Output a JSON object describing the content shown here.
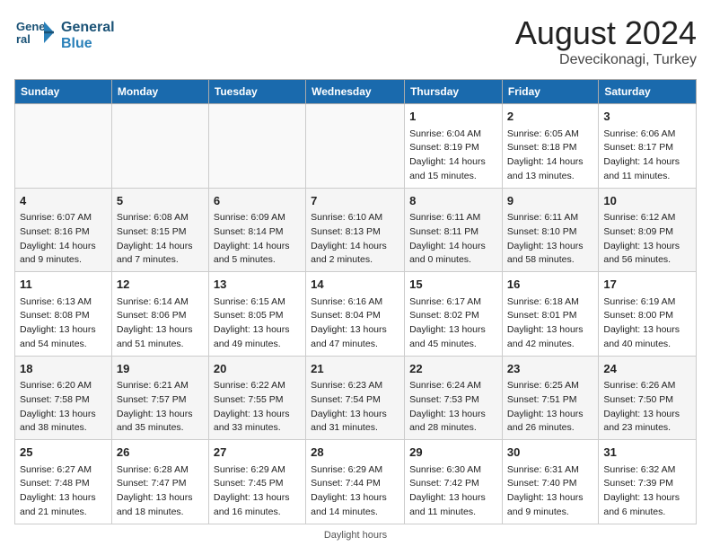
{
  "app": {
    "logo_line1": "General",
    "logo_line2": "Blue"
  },
  "title": {
    "month_year": "August 2024",
    "location": "Devecikonagi, Turkey"
  },
  "days_of_week": [
    "Sunday",
    "Monday",
    "Tuesday",
    "Wednesday",
    "Thursday",
    "Friday",
    "Saturday"
  ],
  "weeks": [
    [
      {
        "day": "",
        "content": ""
      },
      {
        "day": "",
        "content": ""
      },
      {
        "day": "",
        "content": ""
      },
      {
        "day": "",
        "content": ""
      },
      {
        "day": "1",
        "content": "Sunrise: 6:04 AM\nSunset: 8:19 PM\nDaylight: 14 hours and 15 minutes."
      },
      {
        "day": "2",
        "content": "Sunrise: 6:05 AM\nSunset: 8:18 PM\nDaylight: 14 hours and 13 minutes."
      },
      {
        "day": "3",
        "content": "Sunrise: 6:06 AM\nSunset: 8:17 PM\nDaylight: 14 hours and 11 minutes."
      }
    ],
    [
      {
        "day": "4",
        "content": "Sunrise: 6:07 AM\nSunset: 8:16 PM\nDaylight: 14 hours and 9 minutes."
      },
      {
        "day": "5",
        "content": "Sunrise: 6:08 AM\nSunset: 8:15 PM\nDaylight: 14 hours and 7 minutes."
      },
      {
        "day": "6",
        "content": "Sunrise: 6:09 AM\nSunset: 8:14 PM\nDaylight: 14 hours and 5 minutes."
      },
      {
        "day": "7",
        "content": "Sunrise: 6:10 AM\nSunset: 8:13 PM\nDaylight: 14 hours and 2 minutes."
      },
      {
        "day": "8",
        "content": "Sunrise: 6:11 AM\nSunset: 8:11 PM\nDaylight: 14 hours and 0 minutes."
      },
      {
        "day": "9",
        "content": "Sunrise: 6:11 AM\nSunset: 8:10 PM\nDaylight: 13 hours and 58 minutes."
      },
      {
        "day": "10",
        "content": "Sunrise: 6:12 AM\nSunset: 8:09 PM\nDaylight: 13 hours and 56 minutes."
      }
    ],
    [
      {
        "day": "11",
        "content": "Sunrise: 6:13 AM\nSunset: 8:08 PM\nDaylight: 13 hours and 54 minutes."
      },
      {
        "day": "12",
        "content": "Sunrise: 6:14 AM\nSunset: 8:06 PM\nDaylight: 13 hours and 51 minutes."
      },
      {
        "day": "13",
        "content": "Sunrise: 6:15 AM\nSunset: 8:05 PM\nDaylight: 13 hours and 49 minutes."
      },
      {
        "day": "14",
        "content": "Sunrise: 6:16 AM\nSunset: 8:04 PM\nDaylight: 13 hours and 47 minutes."
      },
      {
        "day": "15",
        "content": "Sunrise: 6:17 AM\nSunset: 8:02 PM\nDaylight: 13 hours and 45 minutes."
      },
      {
        "day": "16",
        "content": "Sunrise: 6:18 AM\nSunset: 8:01 PM\nDaylight: 13 hours and 42 minutes."
      },
      {
        "day": "17",
        "content": "Sunrise: 6:19 AM\nSunset: 8:00 PM\nDaylight: 13 hours and 40 minutes."
      }
    ],
    [
      {
        "day": "18",
        "content": "Sunrise: 6:20 AM\nSunset: 7:58 PM\nDaylight: 13 hours and 38 minutes."
      },
      {
        "day": "19",
        "content": "Sunrise: 6:21 AM\nSunset: 7:57 PM\nDaylight: 13 hours and 35 minutes."
      },
      {
        "day": "20",
        "content": "Sunrise: 6:22 AM\nSunset: 7:55 PM\nDaylight: 13 hours and 33 minutes."
      },
      {
        "day": "21",
        "content": "Sunrise: 6:23 AM\nSunset: 7:54 PM\nDaylight: 13 hours and 31 minutes."
      },
      {
        "day": "22",
        "content": "Sunrise: 6:24 AM\nSunset: 7:53 PM\nDaylight: 13 hours and 28 minutes."
      },
      {
        "day": "23",
        "content": "Sunrise: 6:25 AM\nSunset: 7:51 PM\nDaylight: 13 hours and 26 minutes."
      },
      {
        "day": "24",
        "content": "Sunrise: 6:26 AM\nSunset: 7:50 PM\nDaylight: 13 hours and 23 minutes."
      }
    ],
    [
      {
        "day": "25",
        "content": "Sunrise: 6:27 AM\nSunset: 7:48 PM\nDaylight: 13 hours and 21 minutes."
      },
      {
        "day": "26",
        "content": "Sunrise: 6:28 AM\nSunset: 7:47 PM\nDaylight: 13 hours and 18 minutes."
      },
      {
        "day": "27",
        "content": "Sunrise: 6:29 AM\nSunset: 7:45 PM\nDaylight: 13 hours and 16 minutes."
      },
      {
        "day": "28",
        "content": "Sunrise: 6:29 AM\nSunset: 7:44 PM\nDaylight: 13 hours and 14 minutes."
      },
      {
        "day": "29",
        "content": "Sunrise: 6:30 AM\nSunset: 7:42 PM\nDaylight: 13 hours and 11 minutes."
      },
      {
        "day": "30",
        "content": "Sunrise: 6:31 AM\nSunset: 7:40 PM\nDaylight: 13 hours and 9 minutes."
      },
      {
        "day": "31",
        "content": "Sunrise: 6:32 AM\nSunset: 7:39 PM\nDaylight: 13 hours and 6 minutes."
      }
    ]
  ],
  "footer": {
    "daylight_note": "Daylight hours"
  }
}
